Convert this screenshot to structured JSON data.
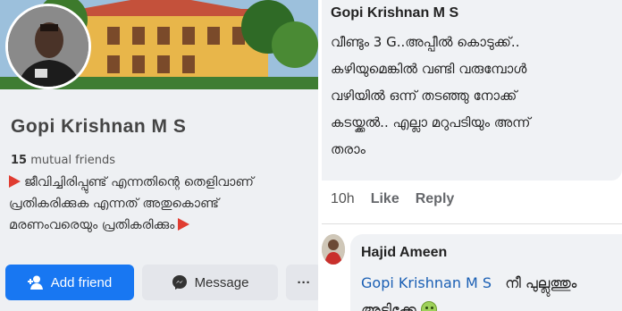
{
  "profile": {
    "name": "Gopi Krishnan M S",
    "mutual_count": "15",
    "mutual_label": "mutual friends",
    "bio_line1": "ജീവിച്ചിരിപ്പുണ്ട് എന്നതിന്റെ തെളിവാണ്",
    "bio_line2": "പ്രതികരിക്കുക എന്നത് അതുകൊണ്ട്",
    "bio_line3": "മരണംവരെയും പ്രതികരിക്കും",
    "add_friend_label": "Add friend",
    "message_label": "Message",
    "more_label": "···"
  },
  "comment": {
    "author": "Gopi Krishnan M S",
    "text_line1": "വീണ്ടും 3 G..അപ്പീൽ കൊടുക്ക്..",
    "text_line2": "കഴിയുമെങ്കിൽ വണ്ടി വരുമ്പോൾ",
    "text_line3": "വഴിയിൽ ഒന്ന് തടഞ്ഞു നോക്ക്",
    "text_line4": "കടയ്ക്കൽ.. എല്ലാ മറുപടിയും അന്ന്",
    "text_line5": "തരാം",
    "time": "10h",
    "like_label": "Like",
    "reply_label": "Reply"
  },
  "reply": {
    "author": "Hajid Ameen",
    "mention": "Gopi Krishnan M S",
    "text": "നീ പുല്ലുത്തും",
    "text_line2": "അടിക്കേ"
  },
  "colors": {
    "brand_blue": "#1877f2",
    "accent_red": "#e03c31",
    "mention_blue": "#1a5fb4"
  }
}
